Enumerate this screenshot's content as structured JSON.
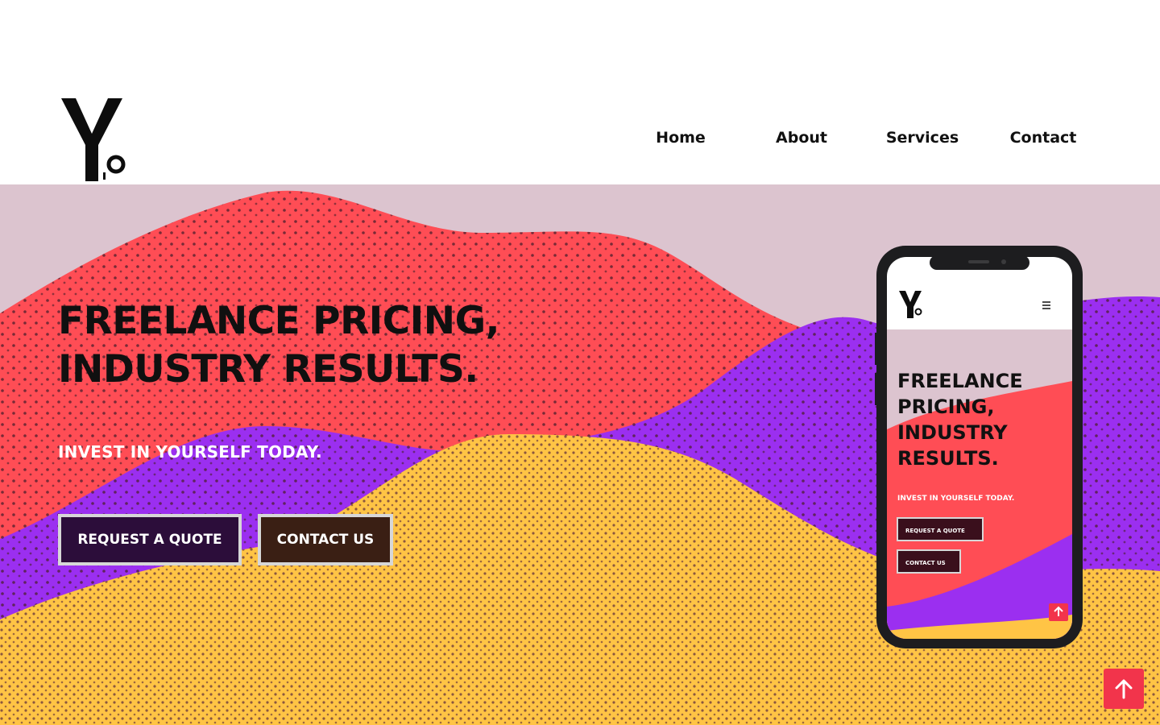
{
  "header": {
    "logo_alt": "Y.o logo",
    "nav": [
      {
        "label": "Home"
      },
      {
        "label": "About"
      },
      {
        "label": "Services"
      },
      {
        "label": "Contact"
      }
    ]
  },
  "hero": {
    "headline_line1": "FREELANCE PRICING,",
    "headline_line2": "INDUSTRY RESULTS.",
    "tagline": "INVEST IN YOURSELF TODAY.",
    "quote_button": "REQUEST A QUOTE",
    "contact_button": "CONTACT US"
  },
  "phone": {
    "headline": [
      "FREELANCE",
      "PRICING,",
      "INDUSTRY",
      "RESULTS."
    ],
    "tagline": "INVEST IN YOURSELF TODAY.",
    "quote_button": "REQUEST A QUOTE",
    "contact_button": "CONTACT US",
    "menu_icon": "hamburger-icon"
  },
  "scroll_top": {
    "icon": "arrow-up-icon"
  },
  "colors": {
    "accent_red": "#f2344b",
    "hero_red": "#ff4d55",
    "hero_purple": "#9b2ff0",
    "hero_yellow": "#ffc445",
    "hero_bg": "#dcc4cf",
    "quote_button_bg": "#2c0d3a",
    "contact_button_bg": "#3a1f14"
  }
}
